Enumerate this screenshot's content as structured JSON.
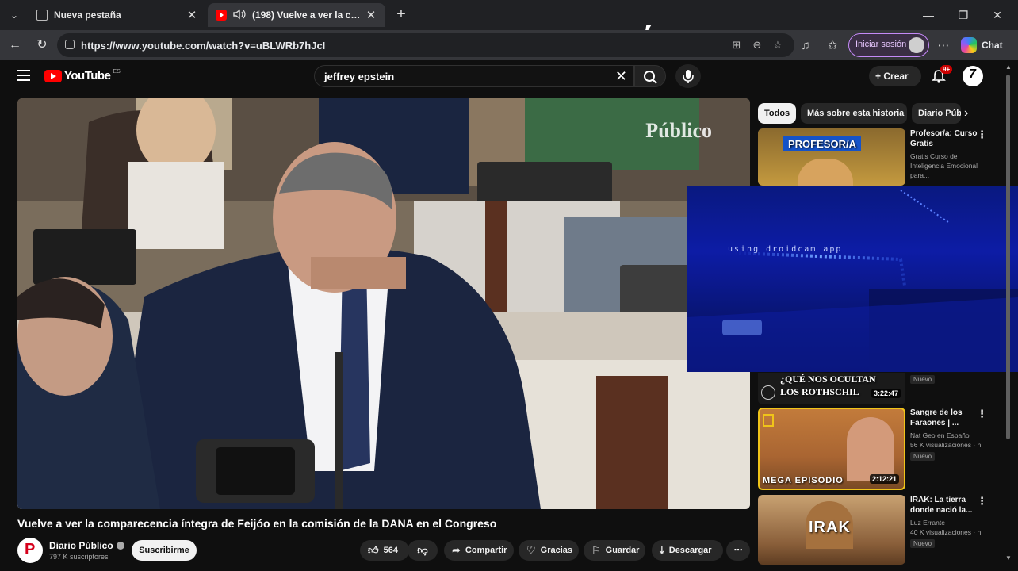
{
  "browser": {
    "tabs": [
      {
        "title": "Nueva pestaña",
        "active": false
      },
      {
        "title": "(198) Vuelve a ver la comparec",
        "active": true
      }
    ],
    "url": "https://www.youtube.com/watch?v=uBLWRb7hJcI",
    "signin_label": "Iniciar sesión",
    "copilot_label": "Chat"
  },
  "youtube": {
    "logo_text": "YouTube",
    "country_code": "ES",
    "search_query": "jeffrey epstein",
    "create_label": "Crear",
    "notification_count": "9+"
  },
  "video": {
    "title": "Vuelve a ver la comparecencia íntegra de Feijóo en la comisión de la DANA en el Congreso",
    "watermark": "Público",
    "channel": {
      "name": "Diario Público",
      "subscribers": "797 K suscriptores",
      "subscribe_label": "Suscribirme"
    },
    "actions": {
      "likes": "564",
      "share": "Compartir",
      "thanks": "Gracias",
      "save": "Guardar",
      "download": "Descargar"
    }
  },
  "overlay": {
    "text": "using droidcam app"
  },
  "sidebar": {
    "chips": [
      "Todos",
      "Más sobre esta historia",
      "Diario Públ"
    ],
    "recommendations": [
      {
        "title": "Profesor/a: Curso Gratis",
        "channel": "Gratis Curso de Inteligencia Emocional para...",
        "thumb_text": "PROFESOR/A"
      },
      {
        "title": "",
        "views": "",
        "badge": "Nuevo",
        "thumb_text": "¿QUÉ NOS OCULTAN LOS ROTHSCHIL",
        "duration": "3:22:47"
      },
      {
        "title": "Sangre de los Faraones | ...",
        "channel": "Nat Geo en Español",
        "views": "56 K visualizaciones · h",
        "badge": "Nuevo",
        "thumb_text": "MEGA EPISODIO",
        "duration": "2:12:21"
      },
      {
        "title": "IRAK: La tierra donde nació la...",
        "channel": "Luz Errante",
        "views": "40 K visualizaciones · h",
        "badge": "Nuevo",
        "thumb_text": "IRAK"
      }
    ]
  },
  "colors": {
    "background": "#0f0f0f",
    "youtube_red": "#ff0000",
    "chip_bg": "#272727",
    "overlay_blue": "#0f1fb0"
  }
}
